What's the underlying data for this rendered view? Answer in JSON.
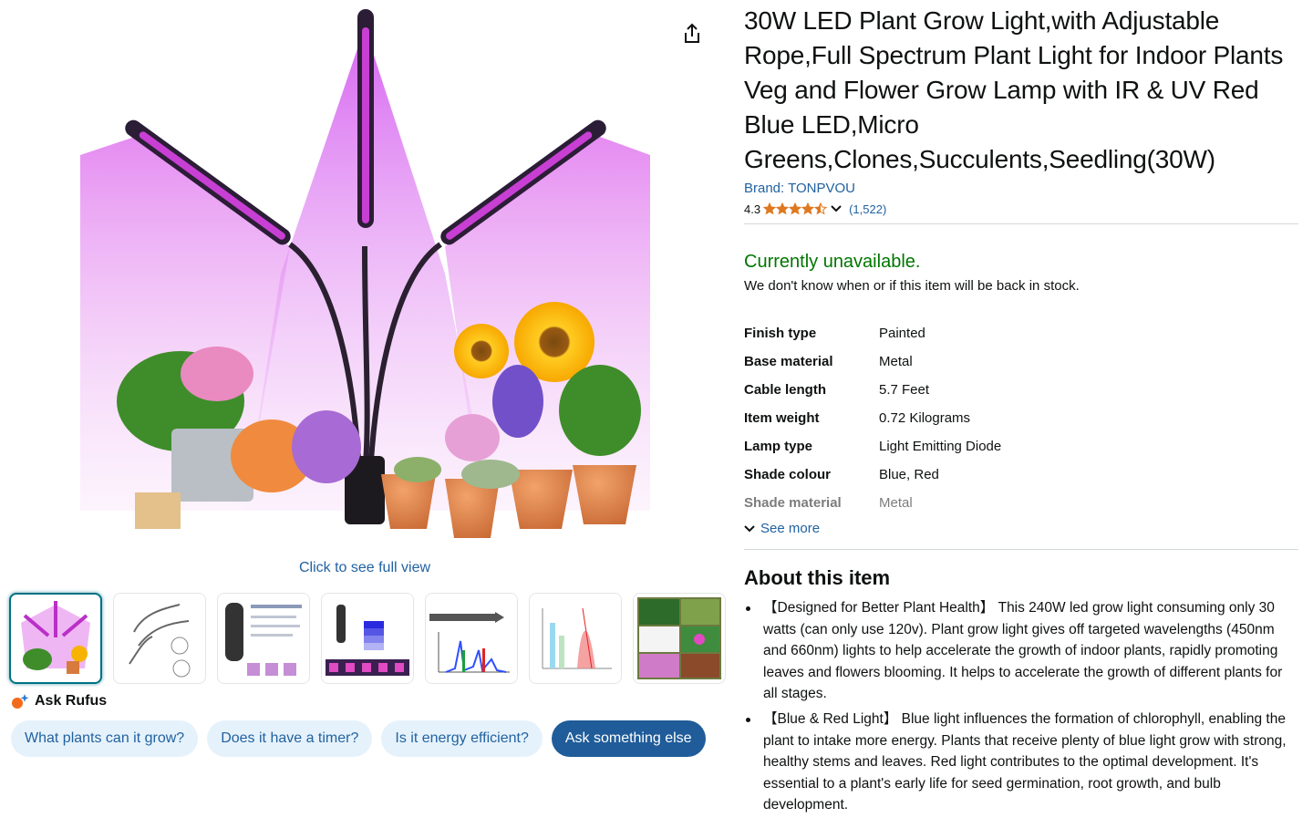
{
  "colors": {
    "link": "#2162a1",
    "available": "#007600",
    "star": "#de7921",
    "chip_bg": "#e6f2fb",
    "chip_primary_bg": "#1f5c99",
    "thumb_active": "#007185"
  },
  "media": {
    "full_view_label": "Click to see full view",
    "thumbnail_icons": [
      "grow-light-photo",
      "three-arm-lamp-drawing",
      "timer-controller",
      "dimming-mode",
      "spectrum-map",
      "spectrum-chart",
      "plant-collage"
    ]
  },
  "rufus": {
    "label": "Ask Rufus",
    "chips": [
      "What plants can it grow?",
      "Does it have a timer?",
      "Is it energy efficient?",
      "Ask something else"
    ]
  },
  "product": {
    "title": "30W LED Plant Grow Light,with Adjustable Rope,Full Spectrum Plant Light for Indoor Plants Veg and Flower Grow Lamp with IR & UV Red Blue LED,Micro Greens,Clones,Succulents,Seedling(30W)",
    "brand": "Brand: TONPVOU",
    "rating": "4.3",
    "stars": 4.3,
    "rating_count": "(1,522)"
  },
  "availability": {
    "status": "Currently unavailable.",
    "note": "We don't know when or if this item will be back in stock."
  },
  "specs": [
    {
      "key": "Finish type",
      "value": "Painted"
    },
    {
      "key": "Base material",
      "value": "Metal"
    },
    {
      "key": "Cable length",
      "value": "5.7 Feet"
    },
    {
      "key": "Item weight",
      "value": "0.72 Kilograms"
    },
    {
      "key": "Lamp type",
      "value": "Light Emitting Diode"
    },
    {
      "key": "Shade colour",
      "value": "Blue, Red"
    },
    {
      "key": "Shade material",
      "value": "Metal"
    }
  ],
  "see_more_label": "See more",
  "about": {
    "heading": "About this item",
    "bullets": [
      "【Designed for Better Plant Health】 This 240W led grow light consuming only 30 watts (can only use 120v). Plant grow light gives off targeted wavelengths (450nm and 660nm) lights to help accelerate the growth of indoor plants, rapidly promoting leaves and flowers blooming. It helps to accelerate the growth of different plants for all stages.",
      "【Blue & Red Light】 Blue light influences the formation of chlorophyll, enabling the plant to intake more energy. Plants that receive plenty of blue light grow with strong, healthy stems and leaves. Red light contributes to the optimal development. It's essential to a plant's early life for seed germination, root growth, and bulb development."
    ]
  }
}
